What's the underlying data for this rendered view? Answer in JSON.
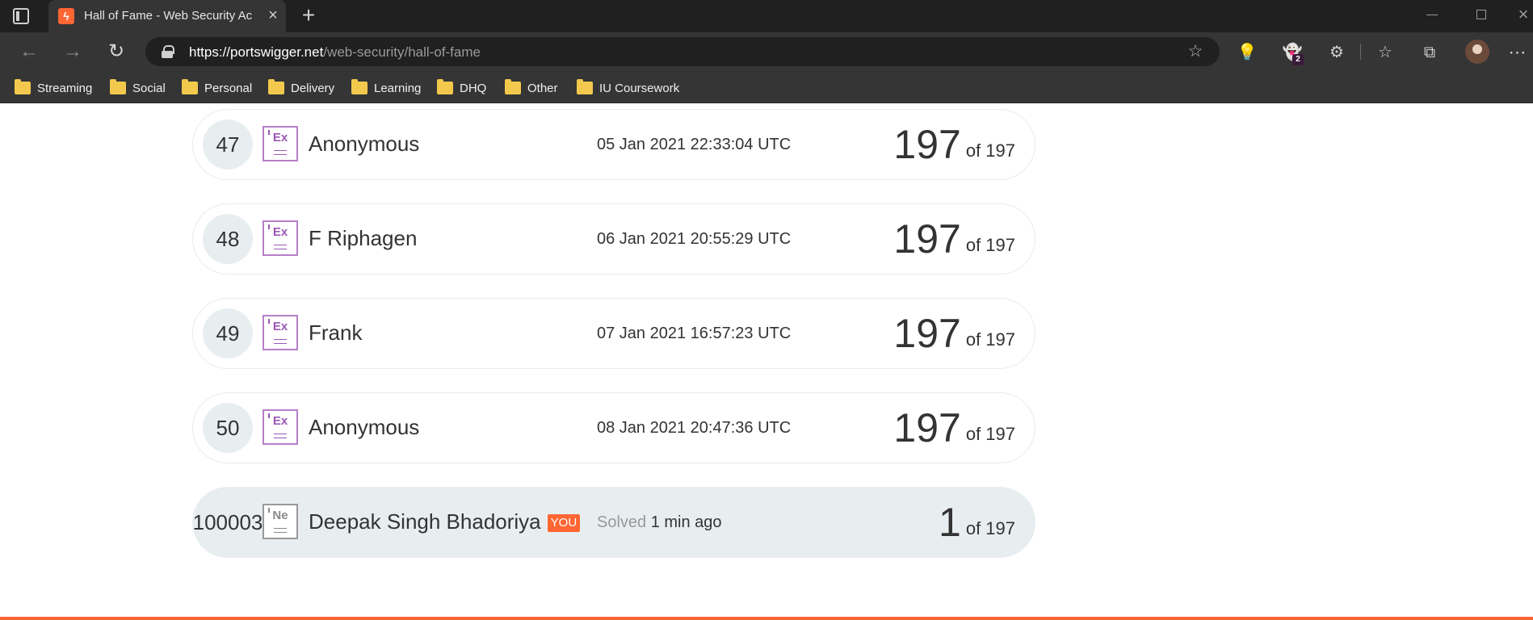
{
  "browser": {
    "tab_title": "Hall of Fame - Web Security Academy",
    "tab_favicon_glyph": "ϟ",
    "url_host": "https://portswigger.net",
    "url_path": "/web-security/hall-of-fame",
    "extension_badge": "2",
    "bookmarks": [
      "Streaming",
      "Social",
      "Personal",
      "Delivery",
      "Learning",
      "DHQ",
      "Other",
      "IU Coursework"
    ]
  },
  "leaderboard": {
    "of_label": "of 197",
    "rows": [
      {
        "rank": "47",
        "level": "Ex",
        "name": "Anonymous",
        "date": "05 Jan 2021 22:33:04 UTC",
        "score": "197"
      },
      {
        "rank": "48",
        "level": "Ex",
        "name": "F Riphagen",
        "date": "06 Jan 2021 20:55:29 UTC",
        "score": "197"
      },
      {
        "rank": "49",
        "level": "Ex",
        "name": "Frank",
        "date": "07 Jan 2021 16:57:23 UTC",
        "score": "197"
      },
      {
        "rank": "50",
        "level": "Ex",
        "name": "Anonymous",
        "date": "08 Jan 2021 20:47:36 UTC",
        "score": "197"
      }
    ],
    "you": {
      "rank": "100003",
      "level": "Ne",
      "name": "Deepak Singh Bhadoriya",
      "badge": "YOU",
      "solved_label": "Solved",
      "solved_time": "1 min ago",
      "score": "1"
    }
  },
  "colors": {
    "accent": "#ff6633",
    "expert": "#9b59b6",
    "row_highlight": "#e8eef0"
  }
}
